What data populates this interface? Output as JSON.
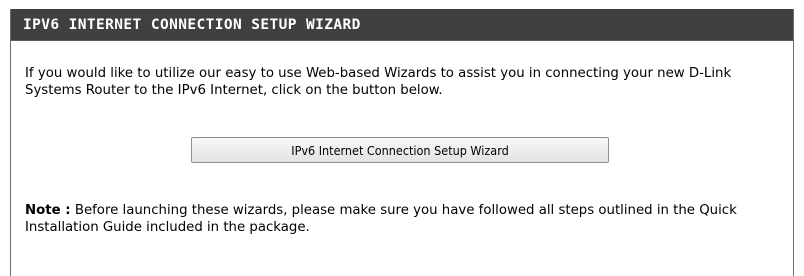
{
  "panel": {
    "title": "IPV6 INTERNET CONNECTION SETUP WIZARD",
    "intro_text": "If you would like to utilize our easy to use Web-based Wizards to assist you in connecting your new D-Link Systems Router to the IPv6 Internet, click on the button below.",
    "wizard_button_label": "IPv6 Internet Connection Setup Wizard",
    "note_label": "Note :",
    "note_text": " Before launching these wizards, please make sure you have followed all steps outlined in the Quick Installation Guide included in the package."
  },
  "colors": {
    "header_background": "#404040",
    "header_text": "#ffffff",
    "panel_border": "#6e6e6e",
    "button_background": "#ececec"
  }
}
